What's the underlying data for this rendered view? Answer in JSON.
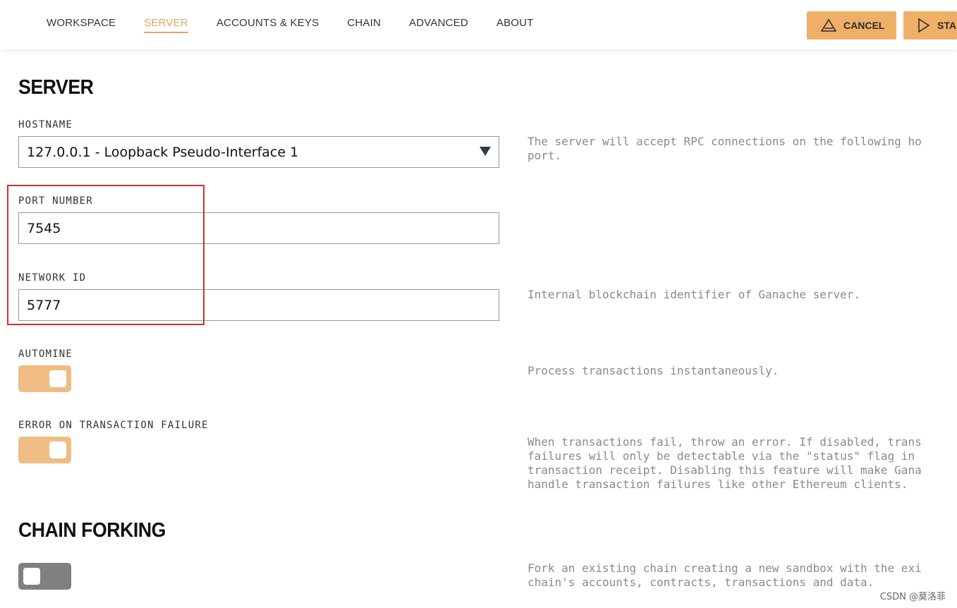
{
  "nav": {
    "tabs": [
      {
        "label": "WORKSPACE"
      },
      {
        "label": "SERVER"
      },
      {
        "label": "ACCOUNTS & KEYS"
      },
      {
        "label": "CHAIN"
      },
      {
        "label": "ADVANCED"
      },
      {
        "label": "ABOUT"
      }
    ],
    "active_tab": "SERVER"
  },
  "toolbar": {
    "cancel_label": "CANCEL",
    "start_label": "STA",
    "cancel_icon": "warning-triangle-icon",
    "start_icon": "play-icon"
  },
  "server": {
    "title": "SERVER",
    "hostname": {
      "label": "HOSTNAME",
      "value": "127.0.0.1 - Loopback Pseudo-Interface 1",
      "help": "The server will accept RPC connections on the following ho\nport."
    },
    "port": {
      "label": "PORT NUMBER",
      "value": "7545"
    },
    "network_id": {
      "label": "NETWORK ID",
      "value": "5777",
      "help": "Internal blockchain identifier of Ganache server."
    },
    "automine": {
      "label": "AUTOMINE",
      "enabled": true,
      "help": "Process transactions instantaneously."
    },
    "error_on_failure": {
      "label": "ERROR ON TRANSACTION FAILURE",
      "enabled": true,
      "help": "When transactions fail, throw an error. If disabled, trans\nfailures will only be detectable via the \"status\" flag in\ntransaction receipt. Disabling this feature will make Gana\nhandle transaction failures like other Ethereum clients."
    }
  },
  "chain_forking": {
    "title": "CHAIN FORKING",
    "enabled": false,
    "help": "Fork an existing chain creating a new sandbox with the exi\nchain's accounts, contracts, transactions and data."
  },
  "watermark": "CSDN @莫洛菲",
  "colors": {
    "accent": "#efaf68",
    "toggle_on": "#efbd83",
    "toggle_off": "#808080",
    "highlight": "#d23030"
  }
}
